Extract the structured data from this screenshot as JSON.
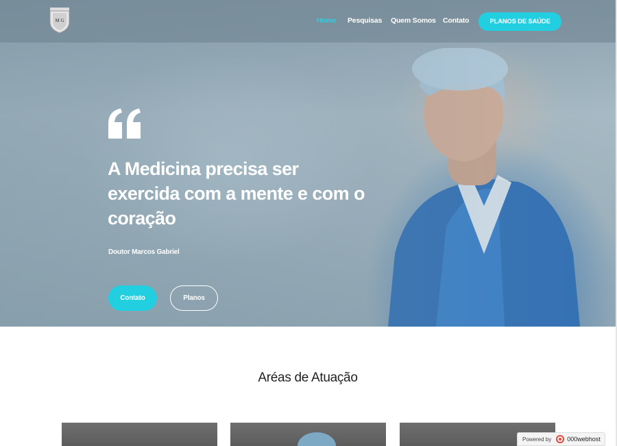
{
  "logo": {
    "initials": "M G"
  },
  "nav": {
    "links": [
      {
        "label": "Home",
        "active": true
      },
      {
        "label": "Pesquisas"
      },
      {
        "label": "Quem Somos"
      },
      {
        "label": "Contato"
      }
    ],
    "cta_label": "PLANOS DE SAÚDE"
  },
  "hero": {
    "quote_lines": [
      "A Medicina precisa ser",
      "exercida com a mente e com o",
      "coração"
    ],
    "author": "Doutor Marcos Gabriel",
    "primary_button": "Contato",
    "secondary_button": "Planos"
  },
  "section": {
    "title": "Aréas de Atuação"
  },
  "badge": {
    "powered_by": "Powered by",
    "brand": "000webhost"
  },
  "colors": {
    "accent": "#22cfe0",
    "hero_overlay": "#7a93a2",
    "scrubs": "#2e74bf"
  },
  "icons": {
    "quote": "quote-icon",
    "logo": "shield-logo-icon",
    "host": "webhost-icon"
  }
}
